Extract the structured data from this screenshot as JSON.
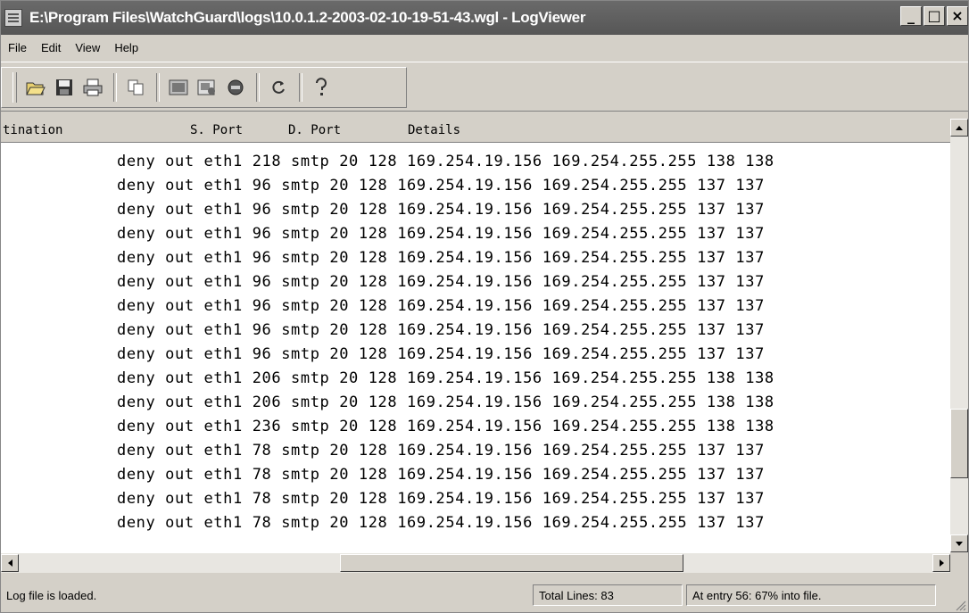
{
  "window": {
    "title": "E:\\Program Files\\WatchGuard\\logs\\10.0.1.2-2003-02-10-19-51-43.wgl - LogViewer",
    "minimize": "_",
    "maximize": "□",
    "close": "×"
  },
  "menu": {
    "items": [
      {
        "label": "File"
      },
      {
        "label": "Edit"
      },
      {
        "label": "View"
      },
      {
        "label": "Help"
      }
    ]
  },
  "toolbar": {
    "icons": [
      "open-icon",
      "save-icon",
      "print-icon",
      "copy-icon",
      "search-icon",
      "filter-icon",
      "stop-icon",
      "refresh-icon",
      "help-icon"
    ]
  },
  "columns": {
    "destination": "tination",
    "s_port": "S. Port",
    "d_port": "D. Port",
    "details": "Details"
  },
  "rows": [
    "deny out eth1 218 smtp 20 128 169.254.19.156 169.254.255.255 138 138",
    "deny out eth1 96 smtp 20 128 169.254.19.156 169.254.255.255 137 137",
    "deny out eth1 96 smtp 20 128 169.254.19.156 169.254.255.255 137 137",
    "deny out eth1 96 smtp 20 128 169.254.19.156 169.254.255.255 137 137",
    "deny out eth1 96 smtp 20 128 169.254.19.156 169.254.255.255 137 137",
    "deny out eth1 96 smtp 20 128 169.254.19.156 169.254.255.255 137 137",
    "deny out eth1 96 smtp 20 128 169.254.19.156 169.254.255.255 137 137",
    "deny out eth1 96 smtp 20 128 169.254.19.156 169.254.255.255 137 137",
    "deny out eth1 96 smtp 20 128 169.254.19.156 169.254.255.255 137 137",
    "deny out eth1 206 smtp 20 128 169.254.19.156 169.254.255.255 138 138",
    "deny out eth1 206 smtp 20 128 169.254.19.156 169.254.255.255 138 138",
    "deny out eth1 236 smtp 20 128 169.254.19.156 169.254.255.255 138 138",
    "deny out eth1 78 smtp 20 128 169.254.19.156 169.254.255.255 137 137",
    "deny out eth1 78 smtp 20 128 169.254.19.156 169.254.255.255 137 137",
    "deny out eth1 78 smtp 20 128 169.254.19.156 169.254.255.255 137 137",
    "deny out eth1 78 smtp 20 128 169.254.19.156 169.254.255.255 137 137"
  ],
  "status": {
    "message": "Log file is loaded.",
    "total_lines": "Total Lines: 83",
    "position": "At entry 56: 67% into file."
  }
}
